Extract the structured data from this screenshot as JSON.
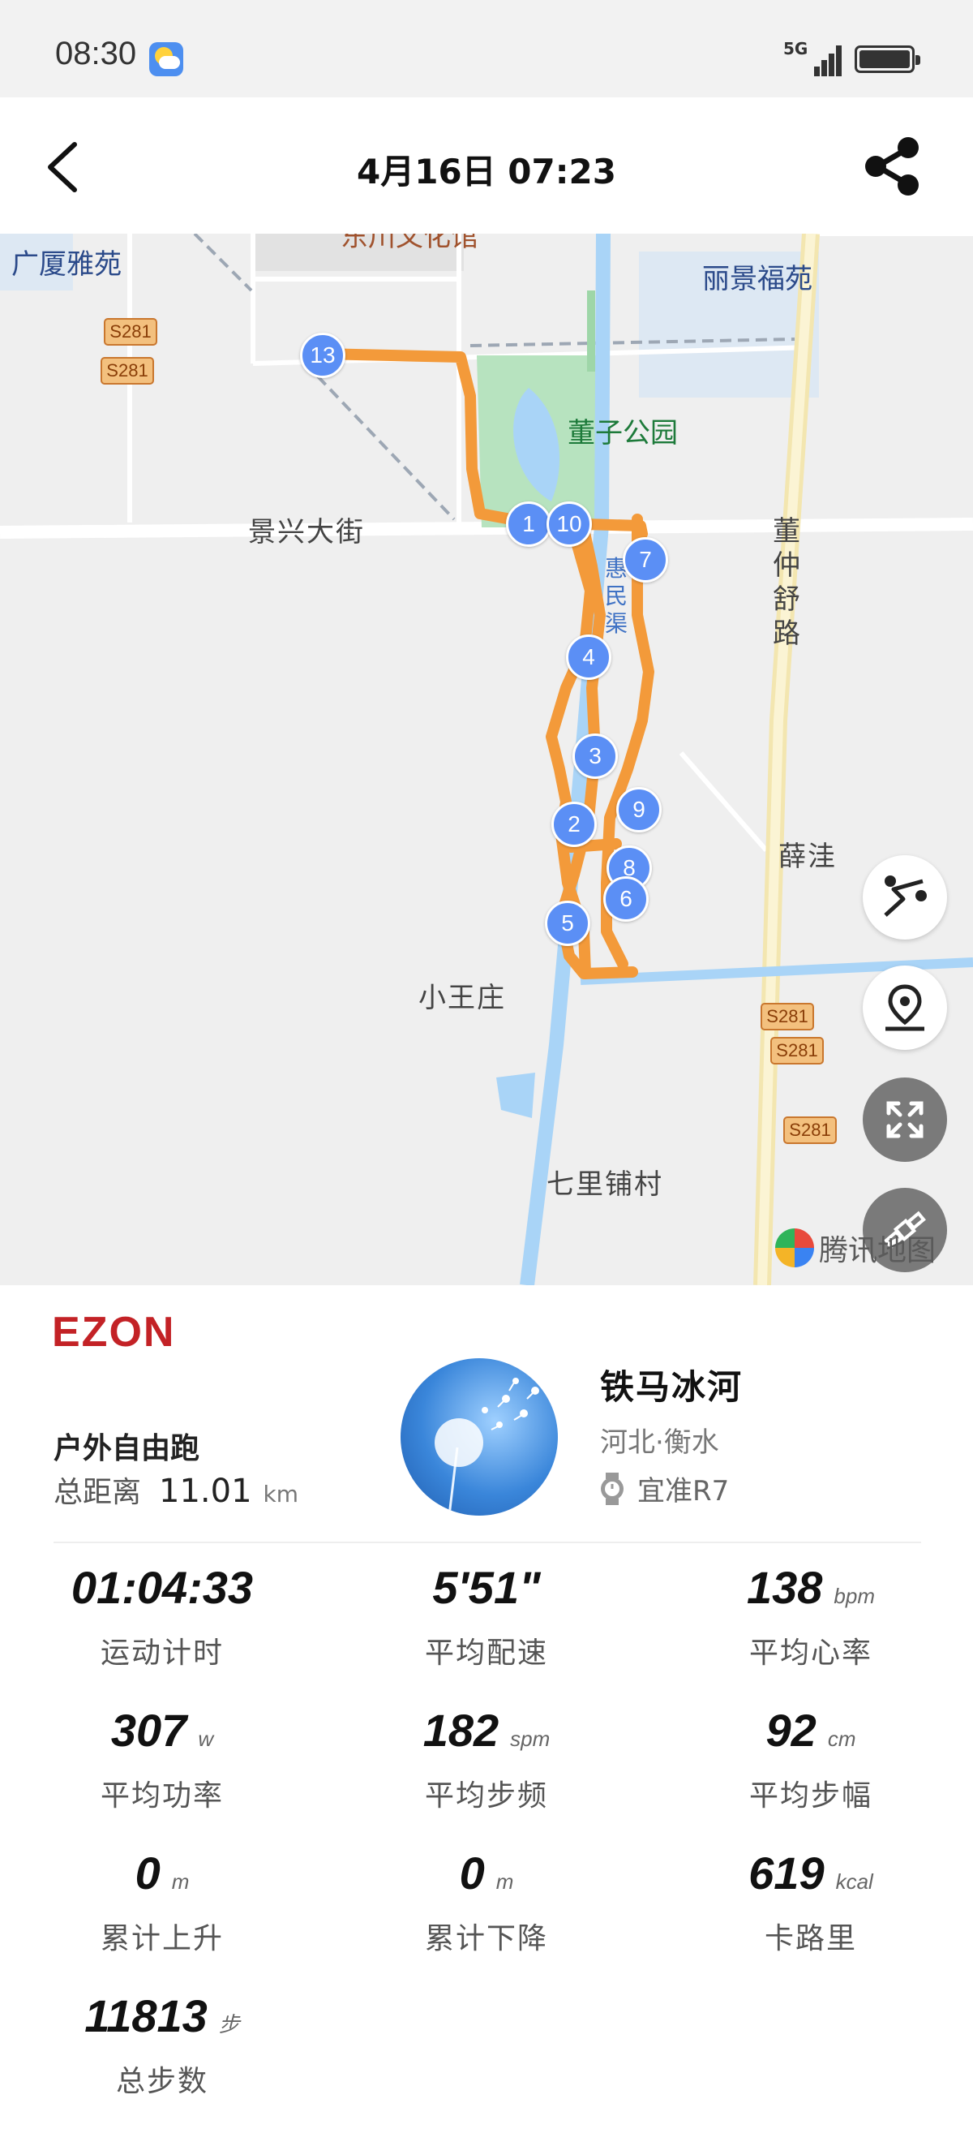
{
  "status_bar": {
    "time": "08:30",
    "network": "5G"
  },
  "header": {
    "title": "4月16日  07:23"
  },
  "map": {
    "labels": {
      "guangsha": "广厦雅苑",
      "wenhua": "东川文化馆",
      "lijing": "丽景福苑",
      "park": "董子公园",
      "jingxing": "景兴大街",
      "dongzhongshu": "董仲舒路",
      "huimin": "惠民渠",
      "xuewa": "薛洼",
      "xiaowang": "小王庄",
      "qilipu": "七里铺村"
    },
    "road_badge": "S281",
    "markers": [
      "13",
      "1",
      "10",
      "7",
      "4",
      "3",
      "2",
      "9",
      "8",
      "6",
      "5"
    ],
    "attribution": "腾讯地图"
  },
  "card": {
    "brand": "EZON",
    "activity_type": "户外自由跑",
    "distance_label": "总距离",
    "distance_value": "11.01",
    "distance_unit": "km",
    "user_name": "铁马冰河",
    "user_location": "河北·衡水",
    "device": "宜准R7",
    "stats": [
      {
        "value": "01:04:33",
        "unit": "",
        "label": "运动计时"
      },
      {
        "value": "5'51\"",
        "unit": "",
        "label": "平均配速"
      },
      {
        "value": "138",
        "unit": "bpm",
        "label": "平均心率"
      },
      {
        "value": "307",
        "unit": "w",
        "label": "平均功率"
      },
      {
        "value": "182",
        "unit": "spm",
        "label": "平均步频"
      },
      {
        "value": "92",
        "unit": "cm",
        "label": "平均步幅"
      },
      {
        "value": "0",
        "unit": "m",
        "label": "累计上升"
      },
      {
        "value": "0",
        "unit": "m",
        "label": "累计下降"
      },
      {
        "value": "619",
        "unit": "kcal",
        "label": "卡路里"
      },
      {
        "value": "11813",
        "unit": "步",
        "label": "总步数"
      }
    ]
  },
  "colors": {
    "route": "#f39a3a",
    "marker": "#5b8ff5",
    "brand": "#c32226",
    "water": "#a9d4f7",
    "park": "#b7e3bf"
  },
  "icons": [
    "back-icon",
    "share-icon",
    "route-order-icon",
    "location-icon",
    "fullscreen-icon",
    "satellite-icon",
    "watch-icon"
  ]
}
